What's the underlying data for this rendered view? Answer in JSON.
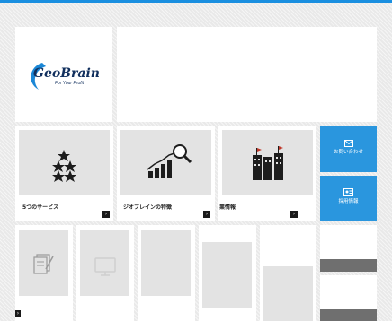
{
  "colors": {
    "accent": "#1a8fe0",
    "tile_blue": "#2a96de",
    "dark_bar": "#6f6f6f"
  },
  "brand": {
    "logo_text": "GeoBrain",
    "tagline": "For Your Profit"
  },
  "services": [
    {
      "label": "5つのサービス",
      "icon": "stars-icon"
    },
    {
      "label": "ジオブレインの特徴",
      "icon": "growth-chart-icon"
    },
    {
      "label": "業情報",
      "icon": "buildings-icon"
    }
  ],
  "side_tiles": [
    {
      "label": "お問い合わせ",
      "icon": "mail-icon"
    },
    {
      "label": "採用情報",
      "icon": "recruit-icon"
    }
  ],
  "arrow_glyph": "›"
}
